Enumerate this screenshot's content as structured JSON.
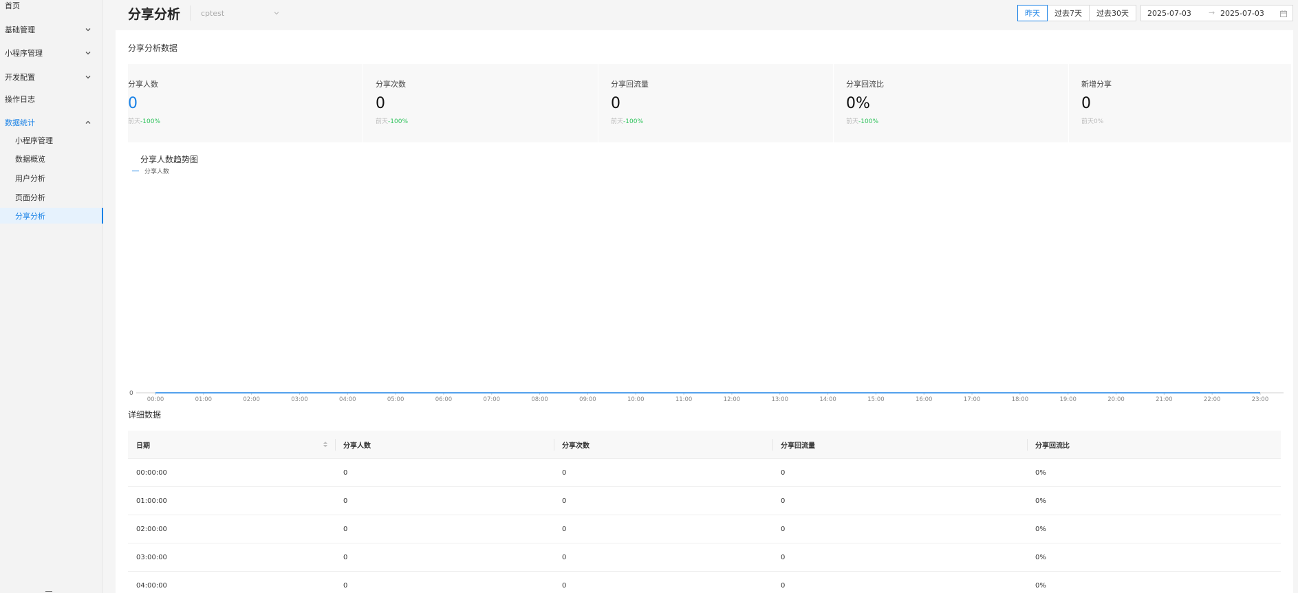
{
  "sidebar": {
    "home": "首页",
    "basic": "基础管理",
    "mini": "小程序管理",
    "dev": "开发配置",
    "logs": "操作日志",
    "stats": "数据统计",
    "sub": [
      "小程序管理",
      "数据概览",
      "用户分析",
      "页面分析",
      "分享分析"
    ]
  },
  "header": {
    "title": "分享分析",
    "app_select": "cptest",
    "ranges": [
      "昨天",
      "过去7天",
      "过去30天"
    ],
    "active_range": "昨天",
    "date_start": "2025-07-03",
    "date_arrow": "→",
    "date_end": "2025-07-03"
  },
  "stats": {
    "section_title": "分享分析数据",
    "cards": [
      {
        "label": "分享人数",
        "value": "0",
        "prev": "前天",
        "pct": "-100%"
      },
      {
        "label": "分享次数",
        "value": "0",
        "prev": "前天",
        "pct": "-100%"
      },
      {
        "label": "分享回流量",
        "value": "0",
        "prev": "前天",
        "pct": "-100%"
      },
      {
        "label": "分享回流比",
        "value": "0%",
        "prev": "前天",
        "pct": "-100%"
      },
      {
        "label": "新增分享",
        "value": "0",
        "prev": "前天",
        "pct": "0%"
      }
    ]
  },
  "chart": {
    "title": "分享人数趋势图",
    "legend": "分享人数"
  },
  "chart_data": {
    "type": "line",
    "title": "分享人数趋势图",
    "x": [
      "00:00",
      "01:00",
      "02:00",
      "03:00",
      "04:00",
      "05:00",
      "06:00",
      "07:00",
      "08:00",
      "09:00",
      "10:00",
      "11:00",
      "12:00",
      "13:00",
      "14:00",
      "15:00",
      "16:00",
      "17:00",
      "18:00",
      "19:00",
      "20:00",
      "21:00",
      "22:00",
      "23:00"
    ],
    "series": [
      {
        "name": "分享人数",
        "values": [
          0,
          0,
          0,
          0,
          0,
          0,
          0,
          0,
          0,
          0,
          0,
          0,
          0,
          0,
          0,
          0,
          0,
          0,
          0,
          0,
          0,
          0,
          0,
          0
        ]
      }
    ],
    "yticks": [
      "0"
    ],
    "ylim": [
      0,
      1
    ],
    "grid": false,
    "legend": "top-left",
    "color": "#1a82e6"
  },
  "table": {
    "title": "详细数据",
    "columns": [
      "日期",
      "分享人数",
      "分享次数",
      "分享回流量",
      "分享回流比"
    ],
    "rows": [
      [
        "00:00:00",
        "0",
        "0",
        "0",
        "0%"
      ],
      [
        "01:00:00",
        "0",
        "0",
        "0",
        "0%"
      ],
      [
        "02:00:00",
        "0",
        "0",
        "0",
        "0%"
      ],
      [
        "03:00:00",
        "0",
        "0",
        "0",
        "0%"
      ],
      [
        "04:00:00",
        "0",
        "0",
        "0",
        "0%"
      ]
    ]
  },
  "colors": {
    "accent": "#1a82e6",
    "positive": "#2ec25b",
    "muted": "#bbbbbb"
  }
}
